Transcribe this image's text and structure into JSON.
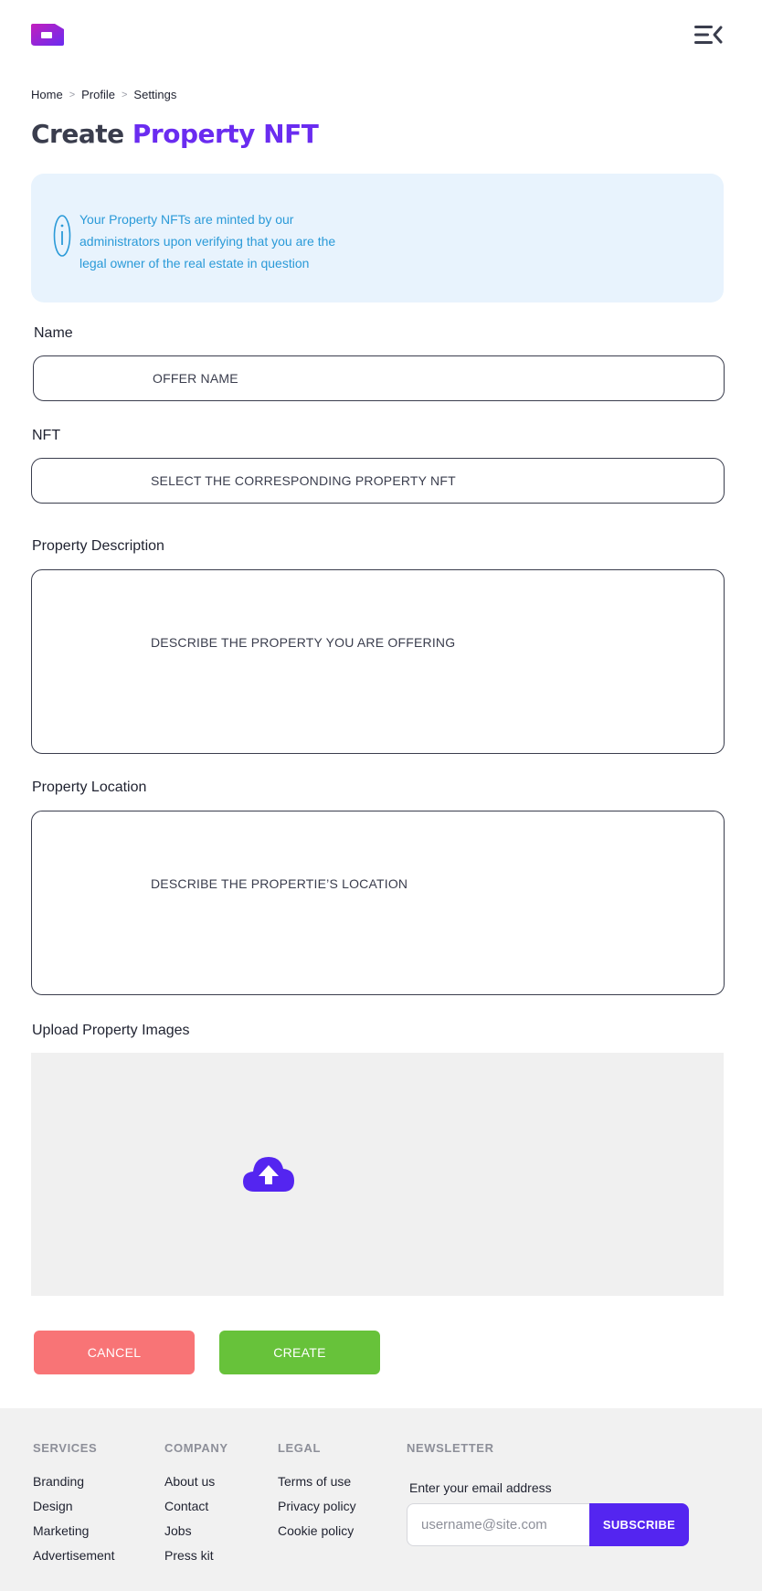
{
  "header": {
    "logo_icon": "logo-icon",
    "menu_icon": "menu-collapse-icon"
  },
  "breadcrumb": {
    "items": [
      "Home",
      "Profile",
      "Settings"
    ],
    "separator": ">"
  },
  "title": {
    "part1": "Create",
    "part2": "Property NFT"
  },
  "info": {
    "text": "Your Property NFTs are minted by our administrators upon verifying that you are the legal owner of the real estate in question",
    "icon": "info-icon"
  },
  "form": {
    "name": {
      "label": "Name",
      "placeholder": "OFFER NAME"
    },
    "nft": {
      "label": "NFT",
      "placeholder": "SELECT THE CORRESPONDING PROPERTY NFT"
    },
    "description": {
      "label": "Property Description",
      "placeholder": "DESCRIBE THE PROPERTY YOU ARE OFFERING"
    },
    "location": {
      "label": "Property Location",
      "placeholder": "DESCRIBE THE PROPERTIE’S LOCATION"
    },
    "images": {
      "label": "Upload Property Images",
      "icon": "cloud-upload-icon"
    }
  },
  "actions": {
    "cancel": "CANCEL",
    "create": "CREATE"
  },
  "footer": {
    "services": {
      "heading": "SERVICES",
      "links": [
        "Branding",
        "Design",
        "Marketing",
        "Advertisement"
      ]
    },
    "company": {
      "heading": "COMPANY",
      "links": [
        "About us",
        "Contact",
        "Jobs",
        "Press kit"
      ]
    },
    "legal": {
      "heading": "LEGAL",
      "links": [
        "Terms of use",
        "Privacy policy",
        "Cookie policy"
      ]
    },
    "newsletter": {
      "heading": "NEWSLETTER",
      "label": "Enter your email address",
      "placeholder": "username@site.com",
      "button": "SUBSCRIBE"
    }
  },
  "colors": {
    "accent": "#6a2cf0",
    "subscribe": "#5425f0",
    "cancel": "#f87476",
    "create": "#67c23a",
    "info_bg": "#e8f3fd",
    "info_text": "#2a9ad8"
  }
}
